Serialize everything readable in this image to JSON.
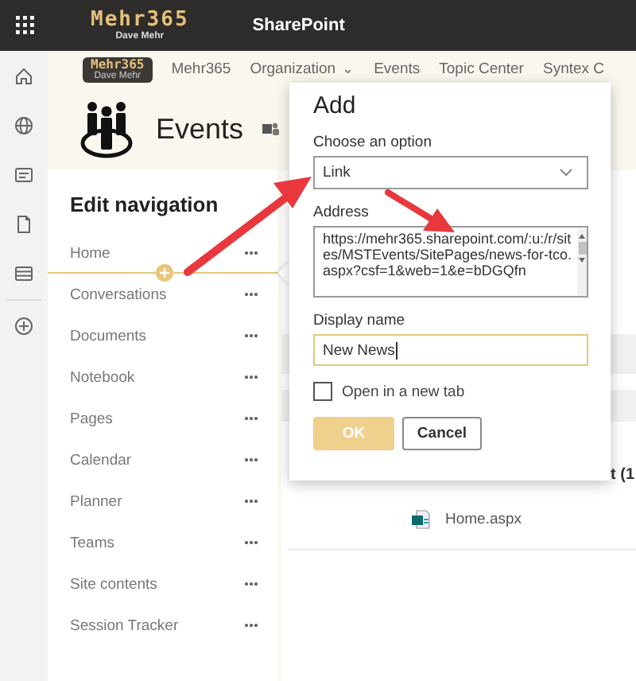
{
  "top_bar": {
    "brand": "Mehr365",
    "brand_sub": "Dave Mehr",
    "app": "SharePoint"
  },
  "hub_nav": {
    "logo": "Mehr365",
    "logo_sub": "Dave Mehr",
    "links": [
      {
        "label": "Mehr365"
      },
      {
        "label": "Organization",
        "caret": "⌄"
      },
      {
        "label": "Events"
      },
      {
        "label": "Topic Center"
      },
      {
        "label": "Syntex C"
      }
    ]
  },
  "site": {
    "title": "Events"
  },
  "edit_navigation": {
    "title": "Edit navigation",
    "items": [
      {
        "label": "Home",
        "insert_below": true
      },
      {
        "label": "Conversations",
        "insert_below": false
      },
      {
        "label": "Documents",
        "insert_below": false
      },
      {
        "label": "Notebook",
        "insert_below": false
      },
      {
        "label": "Pages",
        "insert_below": false
      },
      {
        "label": "Calendar",
        "insert_below": false
      },
      {
        "label": "Planner",
        "insert_below": false
      },
      {
        "label": "Teams",
        "insert_below": false
      },
      {
        "label": "Site contents",
        "insert_below": false
      },
      {
        "label": "Session Tracker",
        "insert_below": false
      }
    ]
  },
  "content": {
    "column_text": "t (1",
    "file": "Home.aspx"
  },
  "dialog": {
    "title": "Add",
    "option_label": "Choose an option",
    "option_value": "Link",
    "address_label": "Address",
    "address_value": "https://mehr365.sharepoint.com/:u:/r/sites/MSTEvents/SitePages/news-for-tco.aspx?csf=1&web=1&e=bDGQfn",
    "name_label": "Display name",
    "name_value": "New News",
    "new_tab_label": "Open in a new tab",
    "new_tab_checked": false,
    "ok": "OK",
    "cancel": "Cancel"
  }
}
